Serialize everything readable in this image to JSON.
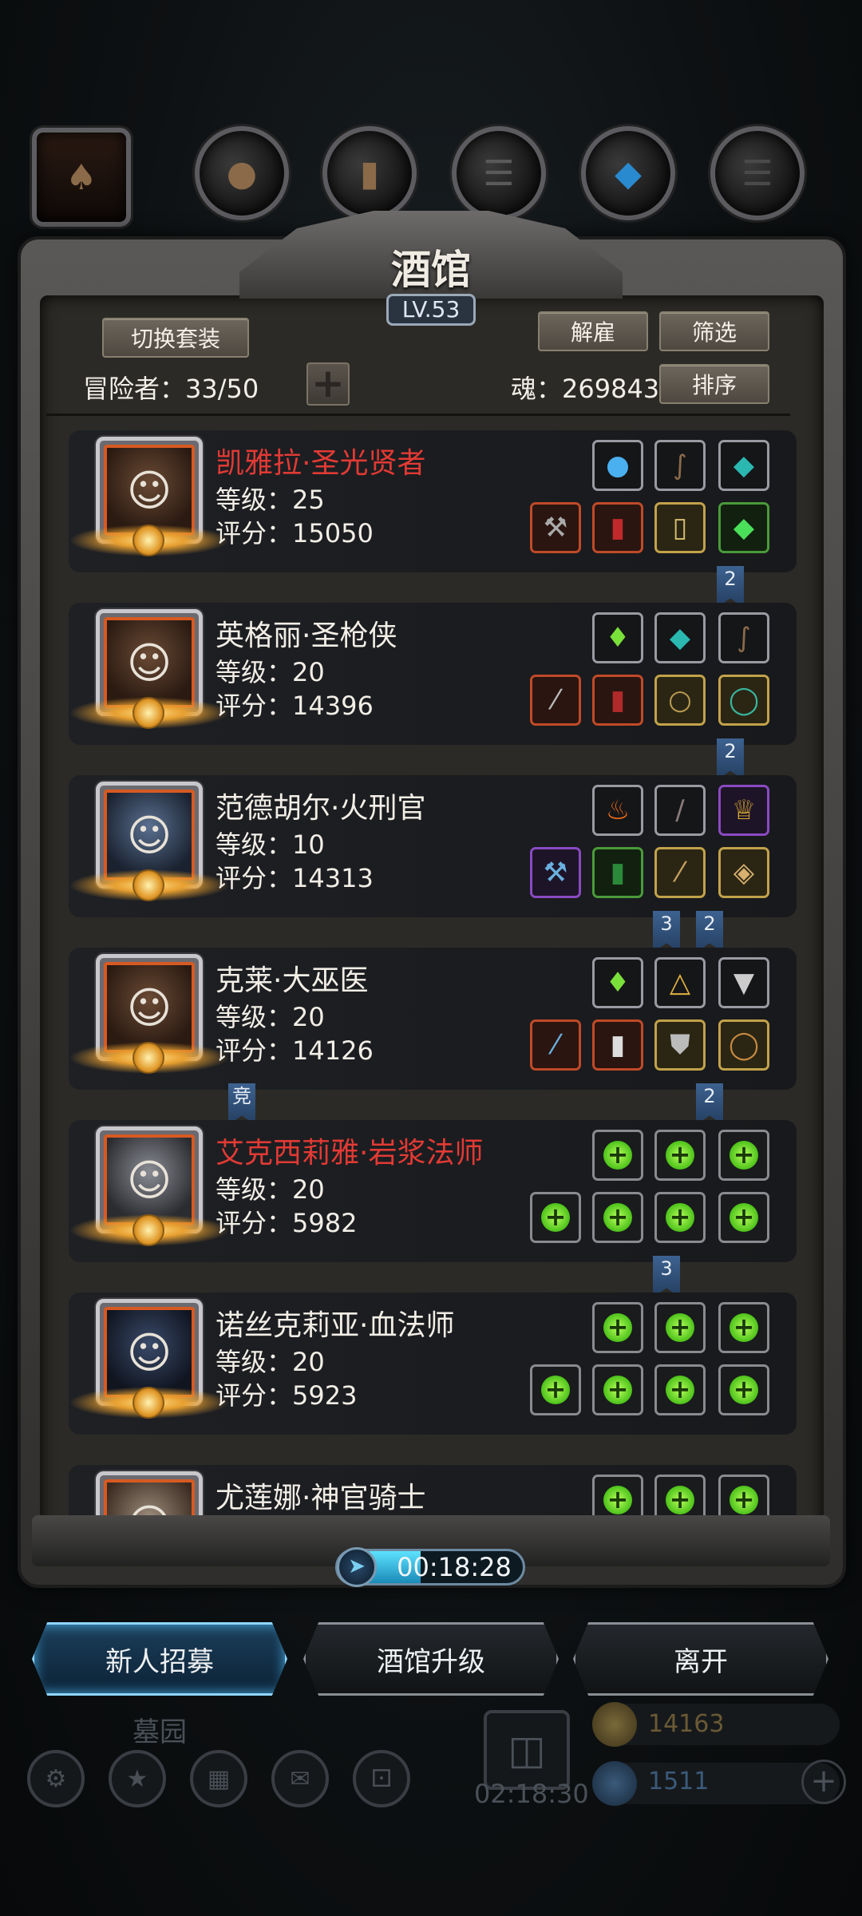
{
  "title": "酒馆",
  "level": "LV.53",
  "buttons": {
    "switch_outfit": "切换套装",
    "dismiss": "解雇",
    "filter": "筛选",
    "sort": "排序",
    "add": "+"
  },
  "stats": {
    "adventurers": "冒险者：33/50",
    "soul": "魂：269843"
  },
  "heroes": [
    {
      "name": "凯雅拉·圣光贤者",
      "level": "等级：25",
      "score": "评分：15050",
      "highlight": true
    },
    {
      "name": "英格丽·圣枪侠",
      "level": "等级：20",
      "score": "评分：14396",
      "highlight": false
    },
    {
      "name": "范德胡尔·火刑官",
      "level": "等级：10",
      "score": "评分：14313",
      "highlight": false
    },
    {
      "name": "克莱·大巫医",
      "level": "等级：20",
      "score": "评分：14126",
      "highlight": false
    },
    {
      "name": "艾克西莉雅·岩浆法师",
      "level": "等级：20",
      "score": "评分：5982",
      "highlight": true
    },
    {
      "name": "诺丝克莉亚·血法师",
      "level": "等级：20",
      "score": "评分：5923",
      "highlight": false
    },
    {
      "name": "尤莲娜·神官骑士",
      "level": "",
      "score": "",
      "highlight": false
    }
  ],
  "ribbons": {
    "r1": "2",
    "r2": "2",
    "r3a": "3",
    "r3b": "2",
    "r4": "2",
    "r4_arena": "竞",
    "r5": "3"
  },
  "timer": {
    "text": "00:18:28",
    "progress": 0.45
  },
  "actions": {
    "recruit": "新人招募",
    "upgrade": "酒馆升级",
    "leave": "离开"
  },
  "background_hud": {
    "graveyard": "墓园",
    "gift_timer": "02:18:30",
    "gold": "14163",
    "gems": "1511"
  },
  "colors": {
    "accent_red_name": "#e23a34",
    "active_button": "#8fd6ff",
    "plus_green": "#4cc21a"
  }
}
